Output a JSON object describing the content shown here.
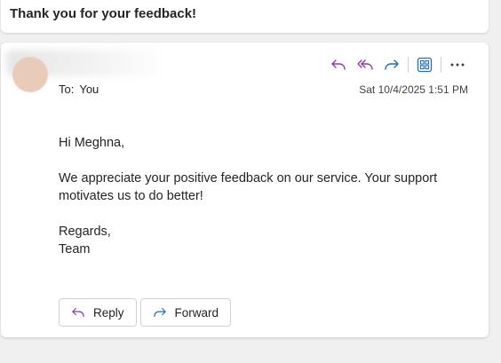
{
  "subject": {
    "title": "Thank you for your feedback!"
  },
  "message": {
    "to_label": "To:",
    "to_value": "You",
    "timestamp": "Sat 10/4/2025 1:51 PM",
    "body": {
      "greeting": "Hi Meghna,",
      "line1": "We appreciate your positive feedback on our service. Your support motivates us to do better!",
      "closing": "Regards,",
      "signature": "Team"
    },
    "toolbar": {
      "icons": [
        "reply-icon",
        "reply-all-icon",
        "forward-icon",
        "apps-icon",
        "more-icon"
      ],
      "colors": {
        "reply": "#8f3aa8",
        "forward": "#1f6fb8",
        "more": "#424242"
      }
    },
    "actions": {
      "reply_label": "Reply",
      "forward_label": "Forward"
    }
  }
}
